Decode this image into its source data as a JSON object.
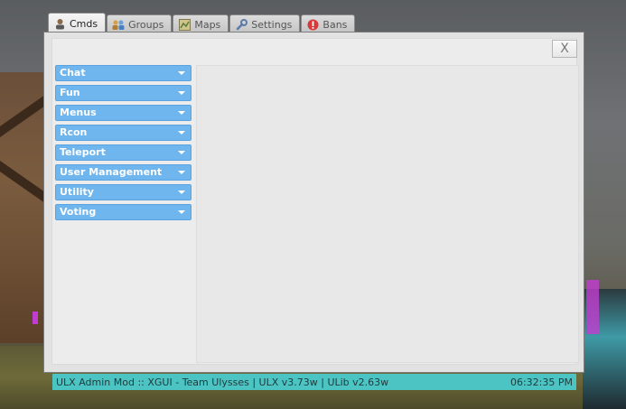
{
  "tabs": [
    {
      "label": "Cmds",
      "icon": "user-icon",
      "active": true
    },
    {
      "label": "Groups",
      "icon": "group-icon",
      "active": false
    },
    {
      "label": "Maps",
      "icon": "map-icon",
      "active": false
    },
    {
      "label": "Settings",
      "icon": "wrench-icon",
      "active": false
    },
    {
      "label": "Bans",
      "icon": "ban-icon",
      "active": false
    }
  ],
  "window": {
    "close_label": "X"
  },
  "categories": [
    {
      "label": "Chat"
    },
    {
      "label": "Fun"
    },
    {
      "label": "Menus"
    },
    {
      "label": "Rcon"
    },
    {
      "label": "Teleport"
    },
    {
      "label": "User Management"
    },
    {
      "label": "Utility"
    },
    {
      "label": "Voting"
    }
  ],
  "status": {
    "left": "ULX Admin Mod :: XGUI - Team Ulysses | ULX v3.73w | ULib v2.63w",
    "time": "06:32:35 PM"
  },
  "colors": {
    "category_bg": "#6fb5ee",
    "status_bg": "#4cc4c4",
    "window_bg": "#e2e2e2"
  }
}
